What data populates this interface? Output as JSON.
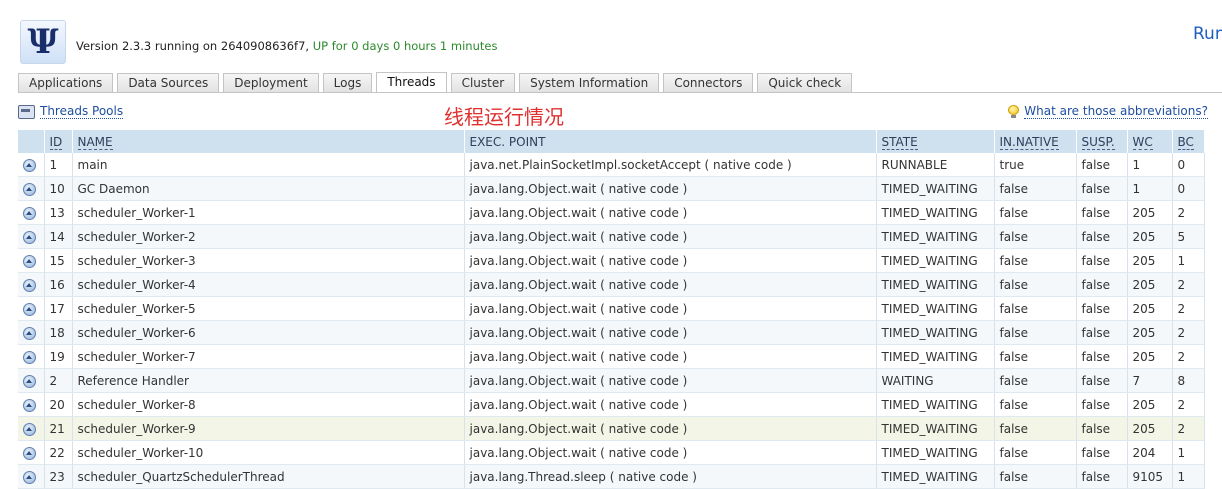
{
  "header": {
    "logo_glyph": "Ψ",
    "version_text": "Version 2.3.3 running on 2640908636f7,",
    "uptime_text": "UP for 0 days 0 hours 1 minutes",
    "run_link": "Run"
  },
  "tabs": [
    {
      "label": "Applications",
      "active": false
    },
    {
      "label": "Data Sources",
      "active": false
    },
    {
      "label": "Deployment",
      "active": false
    },
    {
      "label": "Logs",
      "active": false
    },
    {
      "label": "Threads",
      "active": true
    },
    {
      "label": "Cluster",
      "active": false
    },
    {
      "label": "System Information",
      "active": false
    },
    {
      "label": "Connectors",
      "active": false
    },
    {
      "label": "Quick check",
      "active": false
    }
  ],
  "toolbar": {
    "pools_link": "Threads Pools",
    "title_cn": "线程运行情况",
    "abbr_link": "What are those abbreviations?"
  },
  "table": {
    "columns": [
      "ID",
      "NAME",
      "EXEC. POINT",
      "STATE",
      "IN.NATIVE",
      "SUSP.",
      "WC",
      "BC"
    ],
    "rows": [
      {
        "id": "1",
        "name": "main",
        "exec": "java.net.PlainSocketImpl.socketAccept ( native code )",
        "state": "RUNNABLE",
        "native": "true",
        "susp": "false",
        "wc": "1",
        "bc": "0"
      },
      {
        "id": "10",
        "name": "GC Daemon",
        "exec": "java.lang.Object.wait ( native code )",
        "state": "TIMED_WAITING",
        "native": "false",
        "susp": "false",
        "wc": "1",
        "bc": "0"
      },
      {
        "id": "13",
        "name": "scheduler_Worker-1",
        "exec": "java.lang.Object.wait ( native code )",
        "state": "TIMED_WAITING",
        "native": "false",
        "susp": "false",
        "wc": "205",
        "bc": "2"
      },
      {
        "id": "14",
        "name": "scheduler_Worker-2",
        "exec": "java.lang.Object.wait ( native code )",
        "state": "TIMED_WAITING",
        "native": "false",
        "susp": "false",
        "wc": "205",
        "bc": "5"
      },
      {
        "id": "15",
        "name": "scheduler_Worker-3",
        "exec": "java.lang.Object.wait ( native code )",
        "state": "TIMED_WAITING",
        "native": "false",
        "susp": "false",
        "wc": "205",
        "bc": "1"
      },
      {
        "id": "16",
        "name": "scheduler_Worker-4",
        "exec": "java.lang.Object.wait ( native code )",
        "state": "TIMED_WAITING",
        "native": "false",
        "susp": "false",
        "wc": "205",
        "bc": "2"
      },
      {
        "id": "17",
        "name": "scheduler_Worker-5",
        "exec": "java.lang.Object.wait ( native code )",
        "state": "TIMED_WAITING",
        "native": "false",
        "susp": "false",
        "wc": "205",
        "bc": "2"
      },
      {
        "id": "18",
        "name": "scheduler_Worker-6",
        "exec": "java.lang.Object.wait ( native code )",
        "state": "TIMED_WAITING",
        "native": "false",
        "susp": "false",
        "wc": "205",
        "bc": "2"
      },
      {
        "id": "19",
        "name": "scheduler_Worker-7",
        "exec": "java.lang.Object.wait ( native code )",
        "state": "TIMED_WAITING",
        "native": "false",
        "susp": "false",
        "wc": "205",
        "bc": "2"
      },
      {
        "id": "2",
        "name": "Reference Handler",
        "exec": "java.lang.Object.wait ( native code )",
        "state": "WAITING",
        "native": "false",
        "susp": "false",
        "wc": "7",
        "bc": "8"
      },
      {
        "id": "20",
        "name": "scheduler_Worker-8",
        "exec": "java.lang.Object.wait ( native code )",
        "state": "TIMED_WAITING",
        "native": "false",
        "susp": "false",
        "wc": "205",
        "bc": "2"
      },
      {
        "id": "21",
        "name": "scheduler_Worker-9",
        "exec": "java.lang.Object.wait ( native code )",
        "state": "TIMED_WAITING",
        "native": "false",
        "susp": "false",
        "wc": "205",
        "bc": "2"
      },
      {
        "id": "22",
        "name": "scheduler_Worker-10",
        "exec": "java.lang.Object.wait ( native code )",
        "state": "TIMED_WAITING",
        "native": "false",
        "susp": "false",
        "wc": "204",
        "bc": "1"
      },
      {
        "id": "23",
        "name": "scheduler_QuartzSchedulerThread",
        "exec": "java.lang.Thread.sleep ( native code )",
        "state": "TIMED_WAITING",
        "native": "false",
        "susp": "false",
        "wc": "9105",
        "bc": "1"
      }
    ],
    "highlight_row_index": 11
  },
  "colors": {
    "header_bg": "#cfe0ee",
    "uptime_green": "#2b8a2b",
    "title_red": "#e03030",
    "link_blue": "#1f4fa0"
  }
}
